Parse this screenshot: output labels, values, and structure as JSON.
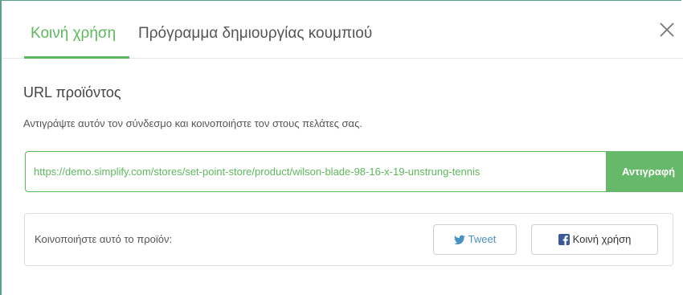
{
  "tabs": [
    {
      "label": "Κοινή χρήση",
      "active": true
    },
    {
      "label": "Πρόγραμμα δημιουργίας κουμπιού",
      "active": false
    }
  ],
  "close_icon": "close-icon",
  "product_url": {
    "title": "URL προϊόντος",
    "description": "Αντιγράψτε αυτόν τον σύνδεσμο και κοινοποιήστε τον στους πελάτες σας.",
    "value": "https://demo.simplify.com/stores/set-point-store/product/wilson-blade-98-16-x-19-unstrung-tennis",
    "copy_label": "Αντιγραφή"
  },
  "share": {
    "label": "Κοινοποιήστε αυτό το προϊόν:",
    "tweet_label": "Tweet",
    "tweet_icon": "twitter-icon",
    "facebook_label": "Κοινή χρήση",
    "facebook_icon": "facebook-icon"
  },
  "colors": {
    "accent": "#5cb85c",
    "copy_button": "#66b96a",
    "twitter": "#4a90c2",
    "facebook": "#3b5998"
  }
}
